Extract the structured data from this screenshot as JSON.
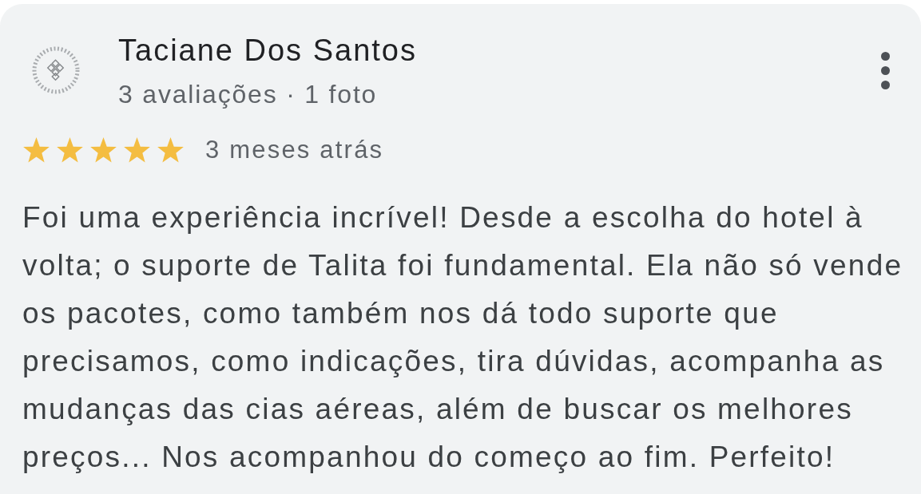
{
  "review": {
    "author": {
      "name": "Taciane Dos Santos",
      "meta": "3 avaliações · 1 foto"
    },
    "stars": 5,
    "time": "3 meses atrás",
    "text": "Foi uma experiência incrível! Desde a escolha do hotel à volta; o suporte de Talita foi fundamental. Ela não só vende os pacotes, como também nos dá todo suporte que precisamos, como indicações, tira dúvidas, acompanha as mudanças das cias aéreas, além de buscar os melhores preços... Nos acompanhou do começo ao fim. Perfeito!"
  }
}
